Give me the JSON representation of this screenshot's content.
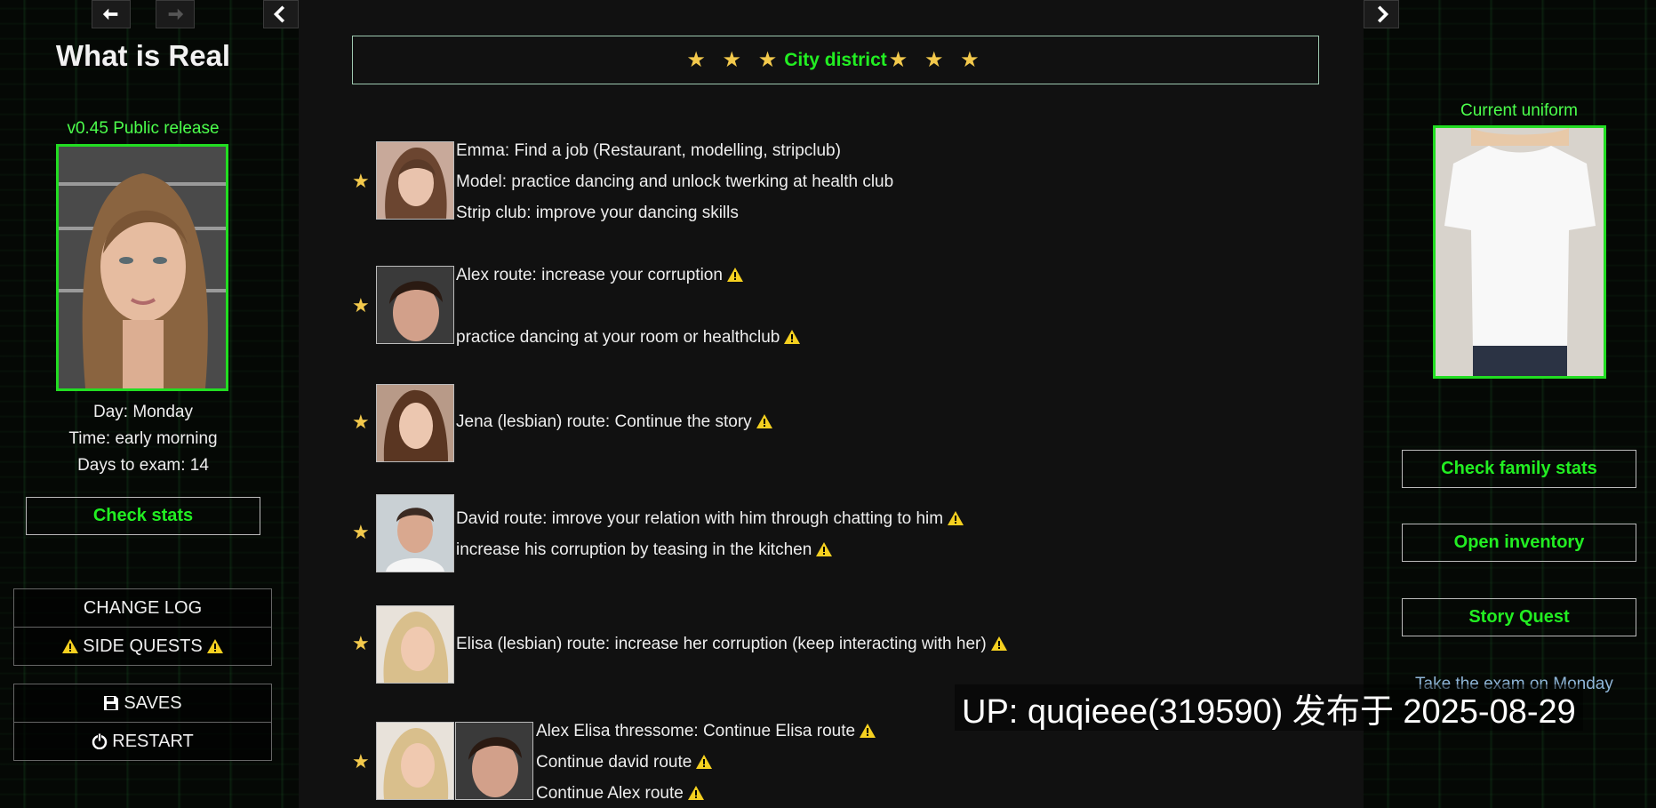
{
  "nav": {
    "back_icon": "back-arrow-icon",
    "forward_icon": "forward-arrow-icon",
    "collapse_icon": "chevron-left-icon",
    "expand_icon": "chevron-right-icon"
  },
  "sidebar": {
    "title": "What is Real",
    "version": "v0.45 Public release",
    "day": "Day: Monday",
    "time": "Time: early morning",
    "days_to_exam": "Days to exam: 14",
    "check_stats": "Check stats",
    "change_log": "CHANGE LOG",
    "side_quests": "SIDE QUESTS",
    "saves": "SAVES",
    "restart": "RESTART"
  },
  "main": {
    "district_stars_left": "★ ★ ★",
    "district_title": "City district",
    "district_stars_right": "★ ★ ★",
    "quests": [
      {
        "lines": [
          "Emma: Find a job (Restaurant, modelling, stripclub)",
          "Model: practice dancing and unlock twerking at health club",
          "Strip club: improve your dancing skills"
        ]
      },
      {
        "lines": [
          "Alex route: increase your corruption",
          "practice dancing at your room or healthclub"
        ]
      },
      {
        "lines": [
          "Jena (lesbian) route: Continue the story"
        ]
      },
      {
        "lines": [
          "David route: imrove your relation with him through chatting to him",
          "increase his corruption by teasing in the kitchen"
        ]
      },
      {
        "lines": [
          "Elisa (lesbian) route: increase her corruption (keep interacting with her)"
        ]
      },
      {
        "lines": [
          "Alex Elisa thressome: Continue Elisa route",
          "Continue david route",
          "Continue Alex route"
        ]
      }
    ],
    "star": "★"
  },
  "right": {
    "uniform_label": "Current uniform",
    "check_family_stats": "Check family stats",
    "open_inventory": "Open inventory",
    "story_quest": "Story Quest",
    "exam_hint": "Take the exam on Monday"
  },
  "watermark": "UP: quqieee(319590) 发布于 2025-08-29",
  "colors": {
    "accent_green": "#22ee22",
    "star_gold": "#f3c94c",
    "warning_yellow": "#f5d020"
  }
}
